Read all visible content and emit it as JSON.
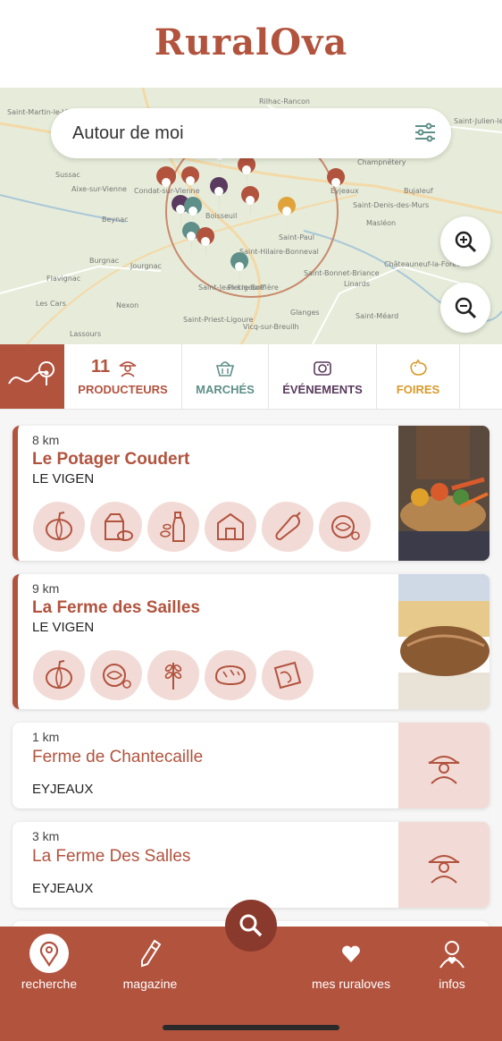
{
  "app": {
    "logo": "RuralOva"
  },
  "map": {
    "search_text": "Autour de moi",
    "places": [
      "Saint-Martin-le-Vieux",
      "Rilhac-Rancon",
      "Condat-sur-Vienne",
      "Eyjeaux",
      "Boisseuil",
      "Saint-Paul",
      "Saint-Hilaire-Bonneval",
      "Pierre-Buffière",
      "Saint-Bonnet-Briance",
      "Linards",
      "Châteauneuf-la-Forêt",
      "Glanges",
      "Saint-Méard",
      "Vicq-sur-Breuilh",
      "Nexon",
      "Les Cars",
      "Flavignac",
      "Burgnac",
      "Jourgnac",
      "Beynac",
      "Saint-Jean-Ligoure",
      "Saint-Priest-Ligoure",
      "Lassours",
      "Sussac",
      "Aixe-sur-Vienne",
      "Champnétery",
      "Bujaleuf",
      "Saint-Julien-le-Petit",
      "Saint-Denis-des-Murs",
      "Masléon"
    ],
    "zoom_in": "zoom-in-icon",
    "zoom_out": "zoom-out-icon"
  },
  "tabs": [
    {
      "count": "11",
      "label": "PRODUCTEURS",
      "color": "#b2533e"
    },
    {
      "count": "",
      "label": "MARCHÉS",
      "color": "#5e8f88"
    },
    {
      "count": "",
      "label": "ÉVÉNEMENTS",
      "color": "#5a3a5e"
    },
    {
      "count": "",
      "label": "FOIRES",
      "color": "#d99a2b"
    }
  ],
  "listings": [
    {
      "distance": "8 km",
      "name": "Le Potager Coudert",
      "city": "LE VIGEN",
      "icons": [
        "pumpkin-icon",
        "milk-cheese-icon",
        "oil-bottle-icon",
        "apron-shop-icon",
        "pepper-icon",
        "salad-icon"
      ]
    },
    {
      "distance": "9 km",
      "name": "La Ferme des Sailles",
      "city": "LE VIGEN",
      "icons": [
        "pumpkin-icon",
        "salad-icon",
        "wheat-icon",
        "bread-icon",
        "meat-icon"
      ]
    },
    {
      "distance": "1 km",
      "name": "Ferme de Chantecaille",
      "city": "EYJEAUX"
    },
    {
      "distance": "3 km",
      "name": "La Ferme Des Salles",
      "city": "EYJEAUX"
    }
  ],
  "nav": [
    {
      "label": "recherche"
    },
    {
      "label": "magazine"
    },
    {
      "label": "mes ruraloves"
    },
    {
      "label": "infos"
    }
  ],
  "colors": {
    "brand": "#b2533e",
    "blob": "#f2dbd6"
  }
}
